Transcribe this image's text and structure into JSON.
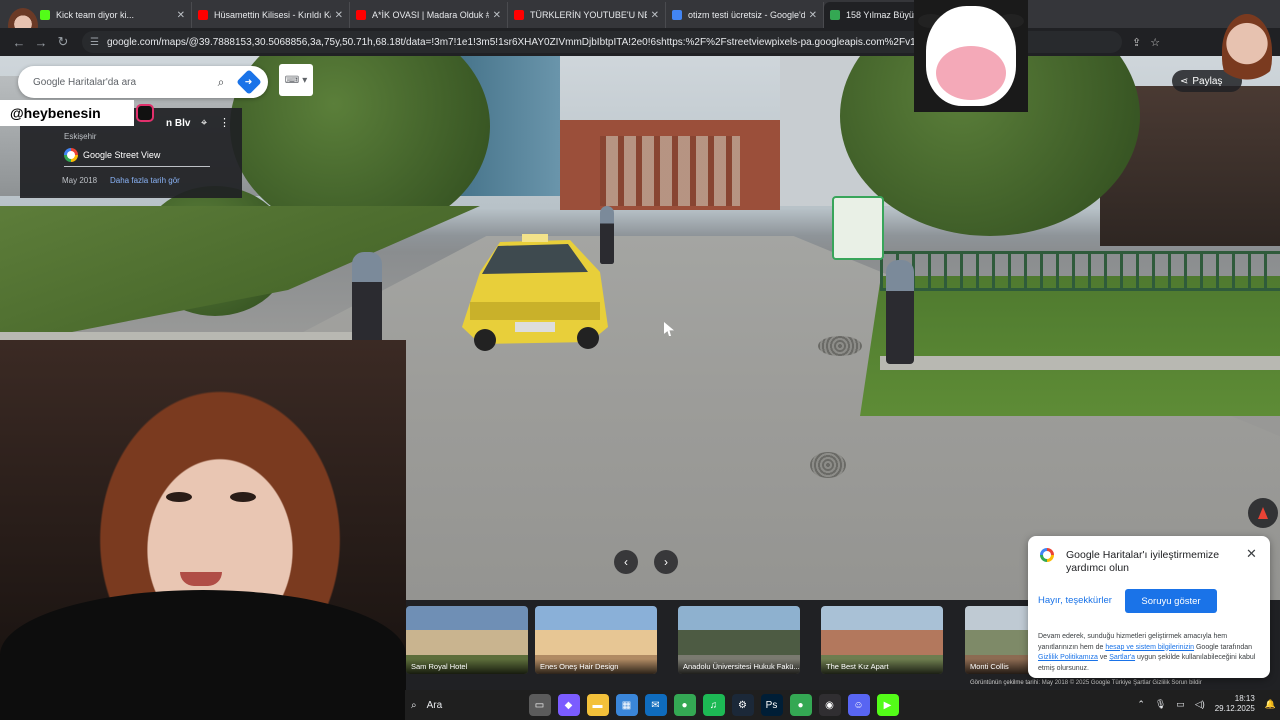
{
  "tabs": [
    {
      "title": "Kick team diyor ki...",
      "favicon": "kick-icon",
      "color": "#53fc18"
    },
    {
      "title": "Hüsamettin Kilisesi - Kırıldı Kar...",
      "favicon": "youtube-icon",
      "color": "#ff0000"
    },
    {
      "title": "A*İK OVASI | Madara Olduk #6...",
      "favicon": "youtube-icon",
      "color": "#ff0000"
    },
    {
      "title": "TÜRKLERİN YOUTUBE'U NEDEN...",
      "favicon": "youtube-icon",
      "color": "#ff0000"
    },
    {
      "title": "otizm testi ücretsiz - Google'da...",
      "favicon": "google-icon",
      "color": "#4285f4"
    },
    {
      "title": "158 Yılmaz Büyüke...",
      "favicon": "maps-icon",
      "color": "#34a853"
    }
  ],
  "address_bar": {
    "url": "google.com/maps/@39.7888153,30.5068856,3a,75y,50.71h,68.18t/data=!3m7!1e1!3m5!1sr6XHAY0ZIVmmDjbIbtpITA!2e0!6shttps:%2F%2Fstreetviewpixels-pa.googleapis.com%2Fv1%2Fthumbnail%..."
  },
  "search": {
    "placeholder": "Google Haritalar'da ara"
  },
  "info_card": {
    "title": "n Blv",
    "city": "Eskişehir",
    "source": "Google Street View",
    "date": "May 2018",
    "more_dates": "Daha fazla tarih gör"
  },
  "streamer_handle": "@heybenesin",
  "share_label": "Paylaş",
  "thumbnails": [
    {
      "caption": "Sam Royal Hotel",
      "colors": [
        "#6f8fb5",
        "#c9b48f",
        "#5d6e3b"
      ]
    },
    {
      "caption": "Enes Oneş Hair Design",
      "colors": [
        "#8ab0d8",
        "#e7c694",
        "#b08a63"
      ]
    },
    {
      "caption": "Anadolu Üniversitesi Hukuk Fakü...",
      "colors": [
        "#8eb1cf",
        "#4d5b43",
        "#7a7a70"
      ]
    },
    {
      "caption": "The Best Kız Apart",
      "colors": [
        "#a9c1d6",
        "#b3785d",
        "#6e7d4f"
      ]
    },
    {
      "caption": "Monti Collis",
      "colors": [
        "#bfcad3",
        "#7e8a68",
        "#8c6b52"
      ]
    }
  ],
  "footer_text": "Görüntünün çekilme tarihi: May 2018   © 2025 Google   Türkiye   Şartlar   Gizlilik   Sorun bildir",
  "popup": {
    "title": "Google Haritalar'ı iyileştirmemize yardımcı olun",
    "decline": "Hayır, teşekkürler",
    "accept": "Soruyu göster",
    "body_1": "Devam ederek, sunduğu hizmetleri geliştirmek amacıyla hem yanıtlarınızın hem de ",
    "link_1": "hesap ve sistem bilgilerinizin",
    "body_2": " Google tarafından ",
    "link_2": "Gizlilik Politikamıza",
    "body_3": " ve ",
    "link_3": "Şartlar'a",
    "body_4": " uygun şekilde kullanılabileceğini kabul etmiş olursunuz."
  },
  "taskbar": {
    "search_label": "Ara",
    "apps": [
      {
        "name": "file-explorer-icon",
        "color": "#5b5b5b",
        "glyph": "▭"
      },
      {
        "name": "copilot-icon",
        "color": "#7b5cff",
        "glyph": "◆"
      },
      {
        "name": "folder-icon",
        "color": "#f3c13a",
        "glyph": "▬"
      },
      {
        "name": "store-icon",
        "color": "#3a86d8",
        "glyph": "▦"
      },
      {
        "name": "outlook-icon",
        "color": "#0f6cbd",
        "glyph": "✉"
      },
      {
        "name": "chrome-icon",
        "color": "#34a853",
        "glyph": "●"
      },
      {
        "name": "spotify-icon",
        "color": "#1db954",
        "glyph": "♫"
      },
      {
        "name": "steam-icon",
        "color": "#1b2838",
        "glyph": "⚙"
      },
      {
        "name": "photoshop-icon",
        "color": "#001e36",
        "glyph": "Ps"
      },
      {
        "name": "chrome-active-icon",
        "color": "#34a853",
        "glyph": "●"
      },
      {
        "name": "obs-icon",
        "color": "#302e31",
        "glyph": "◉"
      },
      {
        "name": "discord-icon",
        "color": "#5865f2",
        "glyph": "☺"
      },
      {
        "name": "kick-app-icon",
        "color": "#53fc18",
        "glyph": "▶"
      }
    ],
    "time": "18:13",
    "date": "29.12.2025"
  },
  "colors": {
    "accent": "#1a73e8",
    "chrome_dark": "#202124",
    "taxi_yellow": "#e8cf3a"
  }
}
